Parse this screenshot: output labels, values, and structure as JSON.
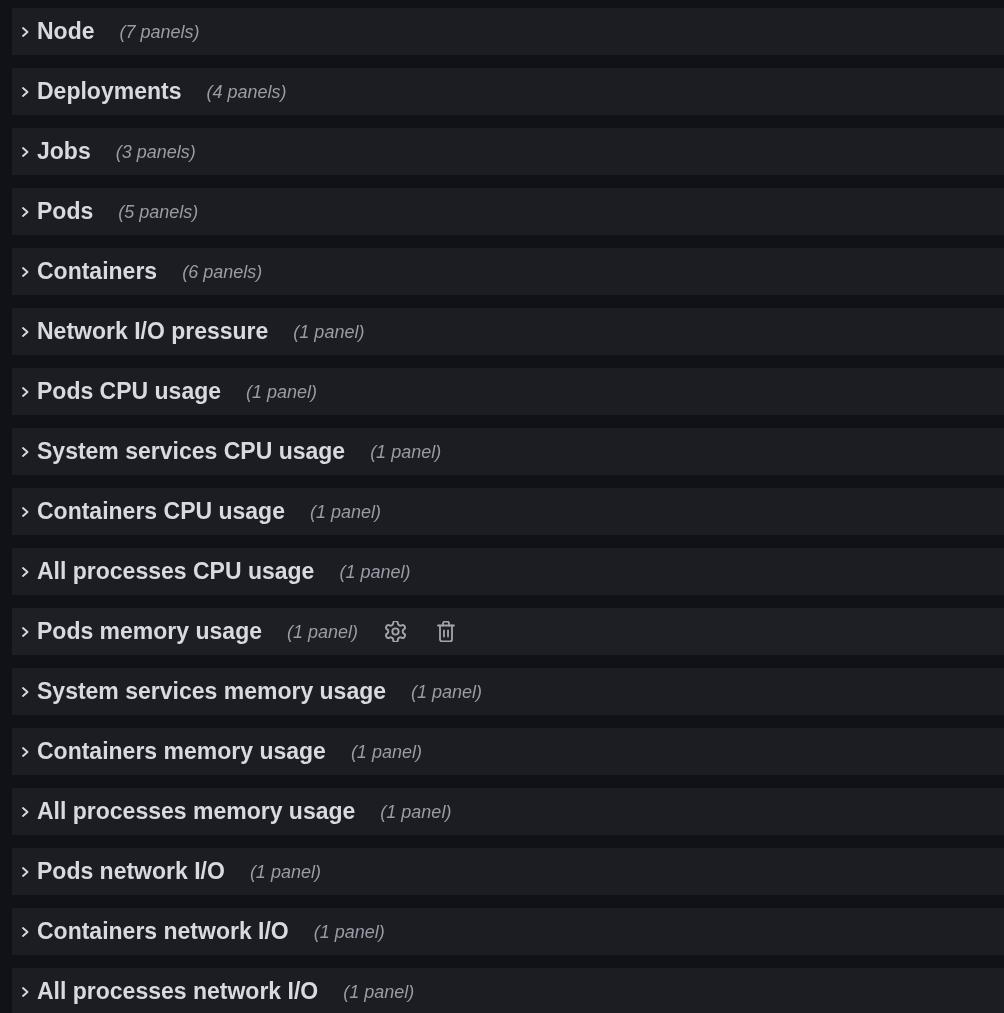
{
  "rows": [
    {
      "title": "Node",
      "count": "(7 panels)",
      "expanded": false,
      "hovered": false
    },
    {
      "title": "Deployments",
      "count": "(4 panels)",
      "expanded": false,
      "hovered": false
    },
    {
      "title": "Jobs",
      "count": "(3 panels)",
      "expanded": false,
      "hovered": false
    },
    {
      "title": "Pods",
      "count": "(5 panels)",
      "expanded": false,
      "hovered": false
    },
    {
      "title": "Containers",
      "count": "(6 panels)",
      "expanded": false,
      "hovered": false
    },
    {
      "title": "Network I/O pressure",
      "count": "(1 panel)",
      "expanded": false,
      "hovered": false
    },
    {
      "title": "Pods CPU usage",
      "count": "(1 panel)",
      "expanded": false,
      "hovered": false
    },
    {
      "title": "System services CPU usage",
      "count": "(1 panel)",
      "expanded": false,
      "hovered": false
    },
    {
      "title": "Containers CPU usage",
      "count": "(1 panel)",
      "expanded": false,
      "hovered": false
    },
    {
      "title": "All processes CPU usage",
      "count": "(1 panel)",
      "expanded": false,
      "hovered": false
    },
    {
      "title": "Pods memory usage",
      "count": "(1 panel)",
      "expanded": false,
      "hovered": true
    },
    {
      "title": "System services memory usage",
      "count": "(1 panel)",
      "expanded": false,
      "hovered": false
    },
    {
      "title": "Containers memory usage",
      "count": "(1 panel)",
      "expanded": false,
      "hovered": false
    },
    {
      "title": "All processes memory usage",
      "count": "(1 panel)",
      "expanded": false,
      "hovered": false
    },
    {
      "title": "Pods network I/O",
      "count": "(1 panel)",
      "expanded": false,
      "hovered": false
    },
    {
      "title": "Containers network I/O",
      "count": "(1 panel)",
      "expanded": false,
      "hovered": false
    },
    {
      "title": "All processes network I/O",
      "count": "(1 panel)",
      "expanded": false,
      "hovered": false
    }
  ]
}
